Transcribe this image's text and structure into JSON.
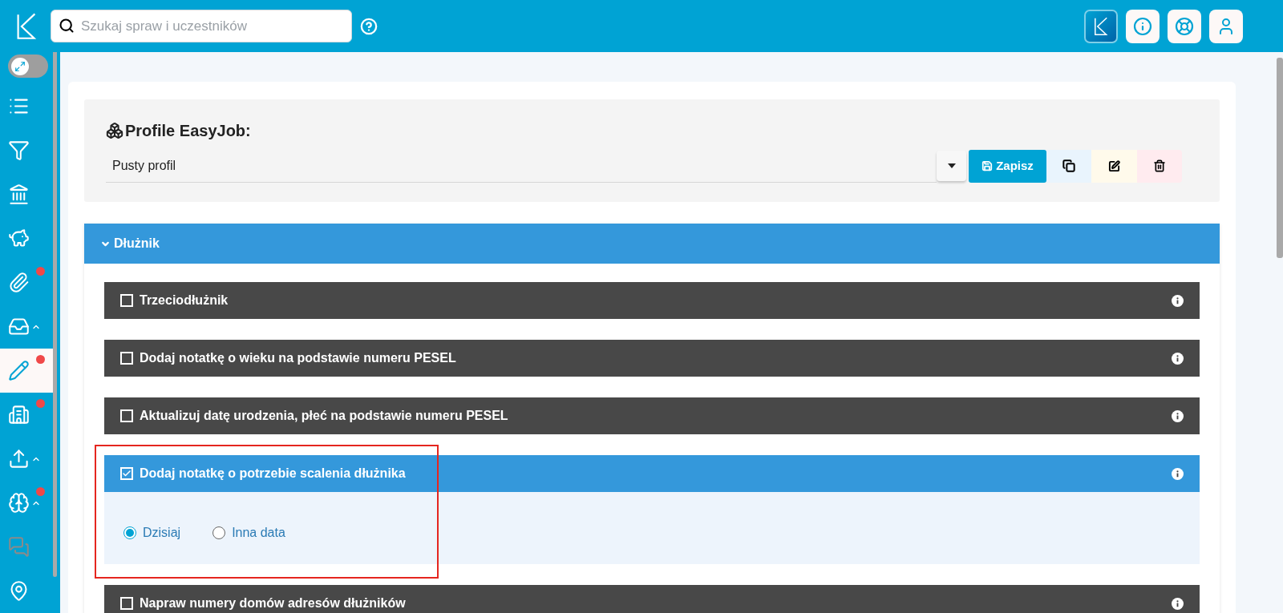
{
  "topbar": {
    "search": {
      "placeholder": "Szukaj spraw i uczestników"
    }
  },
  "sidebar": {
    "expand_toggle": {
      "on": false
    },
    "items": [
      {
        "selected": false,
        "badge": false,
        "expandable": false,
        "disabled": false
      },
      {
        "selected": false,
        "badge": false,
        "expandable": false,
        "disabled": false
      },
      {
        "selected": false,
        "badge": false,
        "expandable": false,
        "disabled": false
      },
      {
        "selected": false,
        "badge": false,
        "expandable": false,
        "disabled": false
      },
      {
        "selected": false,
        "badge": true,
        "expandable": false,
        "disabled": false
      },
      {
        "selected": false,
        "badge": false,
        "expandable": true,
        "disabled": false
      },
      {
        "selected": true,
        "badge": true,
        "expandable": false,
        "disabled": false
      },
      {
        "selected": false,
        "badge": true,
        "expandable": false,
        "disabled": false
      },
      {
        "selected": false,
        "badge": false,
        "expandable": true,
        "disabled": false
      },
      {
        "selected": false,
        "badge": true,
        "expandable": true,
        "disabled": false
      },
      {
        "selected": false,
        "badge": false,
        "expandable": false,
        "disabled": true
      },
      {
        "selected": false,
        "badge": false,
        "expandable": false,
        "disabled": false
      }
    ]
  },
  "profile": {
    "title": "Profile EasyJob:",
    "value": "Pusty profil",
    "save_label": "Zapisz"
  },
  "section": {
    "title": "Dłużnik",
    "expanded": true,
    "items": [
      {
        "label": "Trzeciodłużnik",
        "checked": false
      },
      {
        "label": "Dodaj notatkę o wieku na podstawie numeru PESEL",
        "checked": false
      },
      {
        "label": "Aktualizuj datę urodzenia, płeć na podstawie numeru PESEL",
        "checked": false
      },
      {
        "label": "Dodaj notatkę o potrzebie scalenia dłużnika",
        "checked": true,
        "highlighted": true,
        "options": [
          {
            "label": "Dzisiaj",
            "selected": true
          },
          {
            "label": "Inna data",
            "selected": false
          }
        ]
      },
      {
        "label": "Napraw numery domów adresów dłużników",
        "checked": false
      }
    ]
  }
}
